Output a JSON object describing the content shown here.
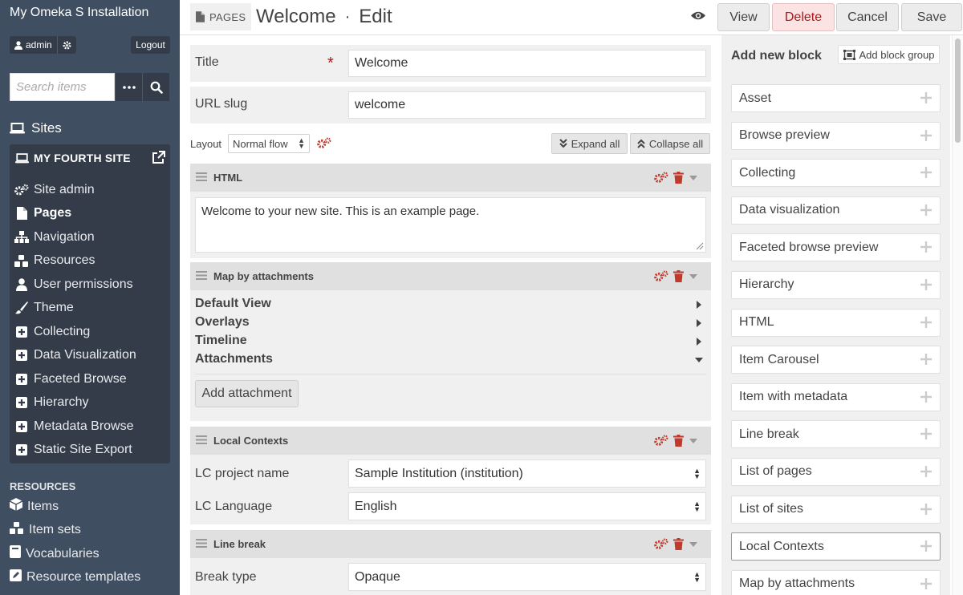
{
  "sidebar": {
    "site_title": "My Omeka S Installation",
    "user": "admin",
    "logout": "Logout",
    "search_placeholder": "Search items",
    "sites_header": "Sites",
    "current_site": "MY FOURTH SITE",
    "site_nav": [
      {
        "label": "Site admin",
        "icon": "gears-icon"
      },
      {
        "label": "Pages",
        "icon": "file-icon",
        "active": true
      },
      {
        "label": "Navigation",
        "icon": "sitemap-icon"
      },
      {
        "label": "Resources",
        "icon": "cubes-icon"
      },
      {
        "label": "User permissions",
        "icon": "user-icon"
      },
      {
        "label": "Theme",
        "icon": "paintbrush-icon"
      },
      {
        "label": "Collecting",
        "icon": "plus-square-icon"
      },
      {
        "label": "Data Visualization",
        "icon": "plus-square-icon"
      },
      {
        "label": "Faceted Browse",
        "icon": "plus-square-icon"
      },
      {
        "label": "Hierarchy",
        "icon": "plus-square-icon"
      },
      {
        "label": "Metadata Browse",
        "icon": "plus-square-icon"
      },
      {
        "label": "Static Site Export",
        "icon": "plus-square-icon"
      }
    ],
    "resources_header": "RESOURCES",
    "resources": [
      {
        "label": "Items",
        "icon": "cube-icon"
      },
      {
        "label": "Item sets",
        "icon": "cubes-icon"
      },
      {
        "label": "Vocabularies",
        "icon": "book-icon"
      },
      {
        "label": "Resource templates",
        "icon": "edit-square-icon"
      }
    ]
  },
  "header": {
    "section": "PAGES",
    "title": "Welcome",
    "separator": "·",
    "mode": "Edit",
    "buttons": {
      "view": "View",
      "delete": "Delete",
      "cancel": "Cancel",
      "save": "Save"
    }
  },
  "form": {
    "title_label": "Title",
    "title_required": "*",
    "title_value": "Welcome",
    "slug_label": "URL slug",
    "slug_value": "welcome",
    "layout_label": "Layout",
    "layout_value": "Normal flow",
    "expand_all": "Expand all",
    "collapse_all": "Collapse all"
  },
  "blocks": {
    "html": {
      "title": "HTML",
      "content": "Welcome to your new site. This is an example page."
    },
    "map": {
      "title": "Map by attachments",
      "sections": [
        "Default View",
        "Overlays",
        "Timeline",
        "Attachments"
      ],
      "add_attachment": "Add attachment"
    },
    "lc": {
      "title": "Local Contexts",
      "project_label": "LC project name",
      "project_value": "Sample Institution (institution)",
      "language_label": "LC Language",
      "language_value": "English"
    },
    "linebreak": {
      "title": "Line break",
      "break_label": "Break type",
      "break_value": "Opaque"
    }
  },
  "right_panel": {
    "title": "Add new block",
    "add_group": "Add block group",
    "items": [
      "Asset",
      "Browse preview",
      "Collecting",
      "Data visualization",
      "Faceted browse preview",
      "Hierarchy",
      "HTML",
      "Item Carousel",
      "Item with metadata",
      "Line break",
      "List of pages",
      "List of sites",
      "Local Contexts",
      "Map by attachments"
    ]
  },
  "colors": {
    "sidebar": "#404e61",
    "sidebar_box": "#333c48",
    "danger": "#a91919",
    "panel": "#f0f0f0"
  }
}
